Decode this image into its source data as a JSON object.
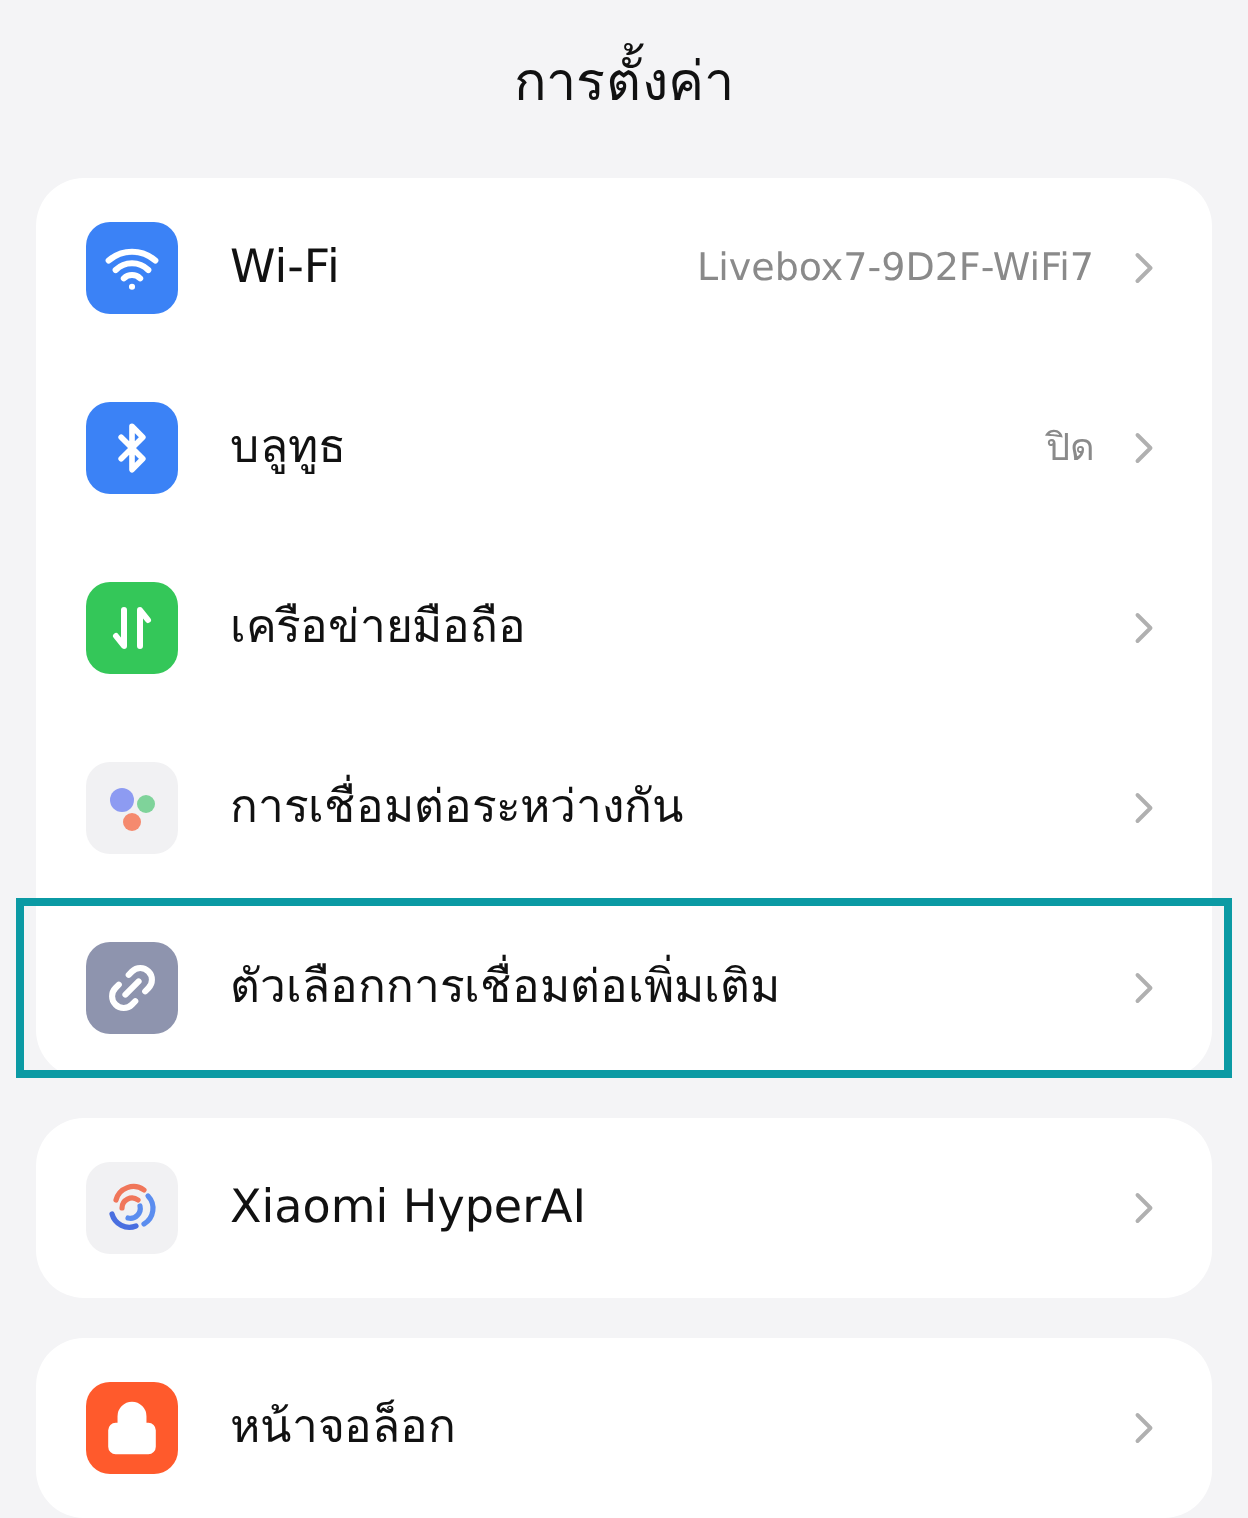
{
  "title": "การตั้งค่า",
  "groups": [
    {
      "rows": [
        {
          "label": "Wi-Fi",
          "value": "Livebox7-9D2F-WiFi7",
          "highlighted": false
        },
        {
          "label": "บลูทูธ",
          "value": "ปิด",
          "highlighted": false
        },
        {
          "label": "เครือข่ายมือถือ",
          "highlighted": false
        },
        {
          "label": "การเชื่อมต่อระหว่างกัน",
          "highlighted": false
        },
        {
          "label": "ตัวเลือกการเชื่อมต่อเพิ่มเติม",
          "highlighted": true
        }
      ]
    },
    {
      "rows": [
        {
          "label": "Xiaomi HyperAI",
          "highlighted": false
        }
      ]
    },
    {
      "rows": [
        {
          "label": "หน้าจอล็อก",
          "highlighted": false
        }
      ]
    }
  ]
}
